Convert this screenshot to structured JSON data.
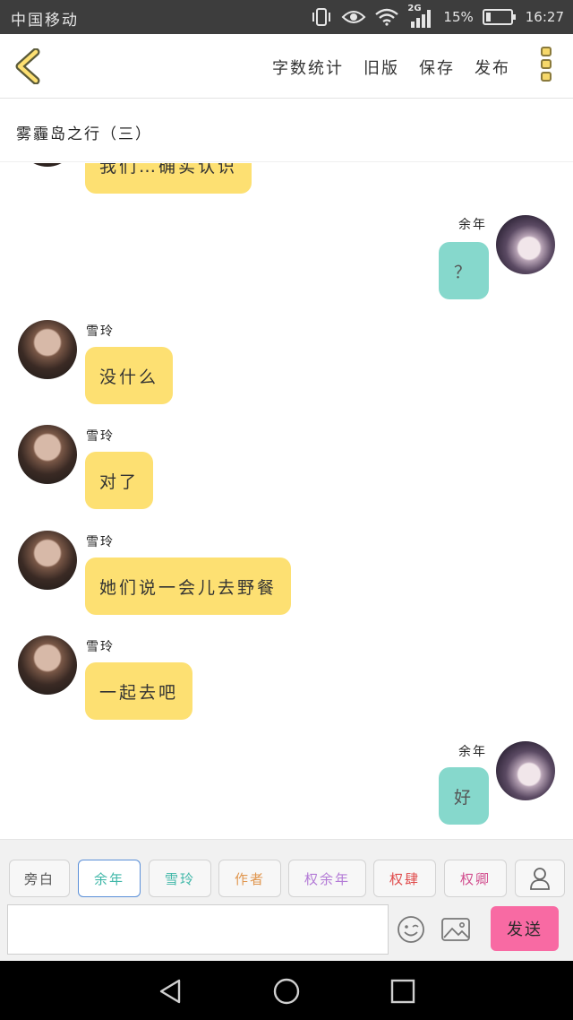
{
  "status_bar": {
    "carrier": "中国移动",
    "network": "2G",
    "battery": "15%",
    "time": "16:27"
  },
  "header": {
    "actions": [
      "字数统计",
      "旧版",
      "保存",
      "发布"
    ]
  },
  "title": "雾霾岛之行（三）",
  "messages": [
    {
      "side": "left",
      "name": "",
      "text": "我们…确实认识",
      "partial": true
    },
    {
      "side": "right",
      "name": "余年",
      "text": "？"
    },
    {
      "side": "left",
      "name": "雪玲",
      "text": "没什么"
    },
    {
      "side": "left",
      "name": "雪玲",
      "text": "对了"
    },
    {
      "side": "left",
      "name": "雪玲",
      "text": "她们说一会儿去野餐"
    },
    {
      "side": "left",
      "name": "雪玲",
      "text": "一起去吧"
    },
    {
      "side": "right",
      "name": "余年",
      "text": "好"
    }
  ],
  "tags": [
    {
      "label": "旁白",
      "color": "#555555"
    },
    {
      "label": "余年",
      "color": "#3fb7a8",
      "active": true
    },
    {
      "label": "雪玲",
      "color": "#3fb7a8"
    },
    {
      "label": "作者",
      "color": "#e0964e"
    },
    {
      "label": "权余年",
      "color": "#b37ad6"
    },
    {
      "label": "权肆",
      "color": "#e04b4b"
    },
    {
      "label": "权卿",
      "color": "#d24e8e"
    }
  ],
  "input": {
    "value": "",
    "placeholder": ""
  },
  "send_label": "发送",
  "colors": {
    "accent_yellow": "#fde072",
    "accent_teal": "#86d8cc",
    "send_pink": "#f86aa3"
  }
}
